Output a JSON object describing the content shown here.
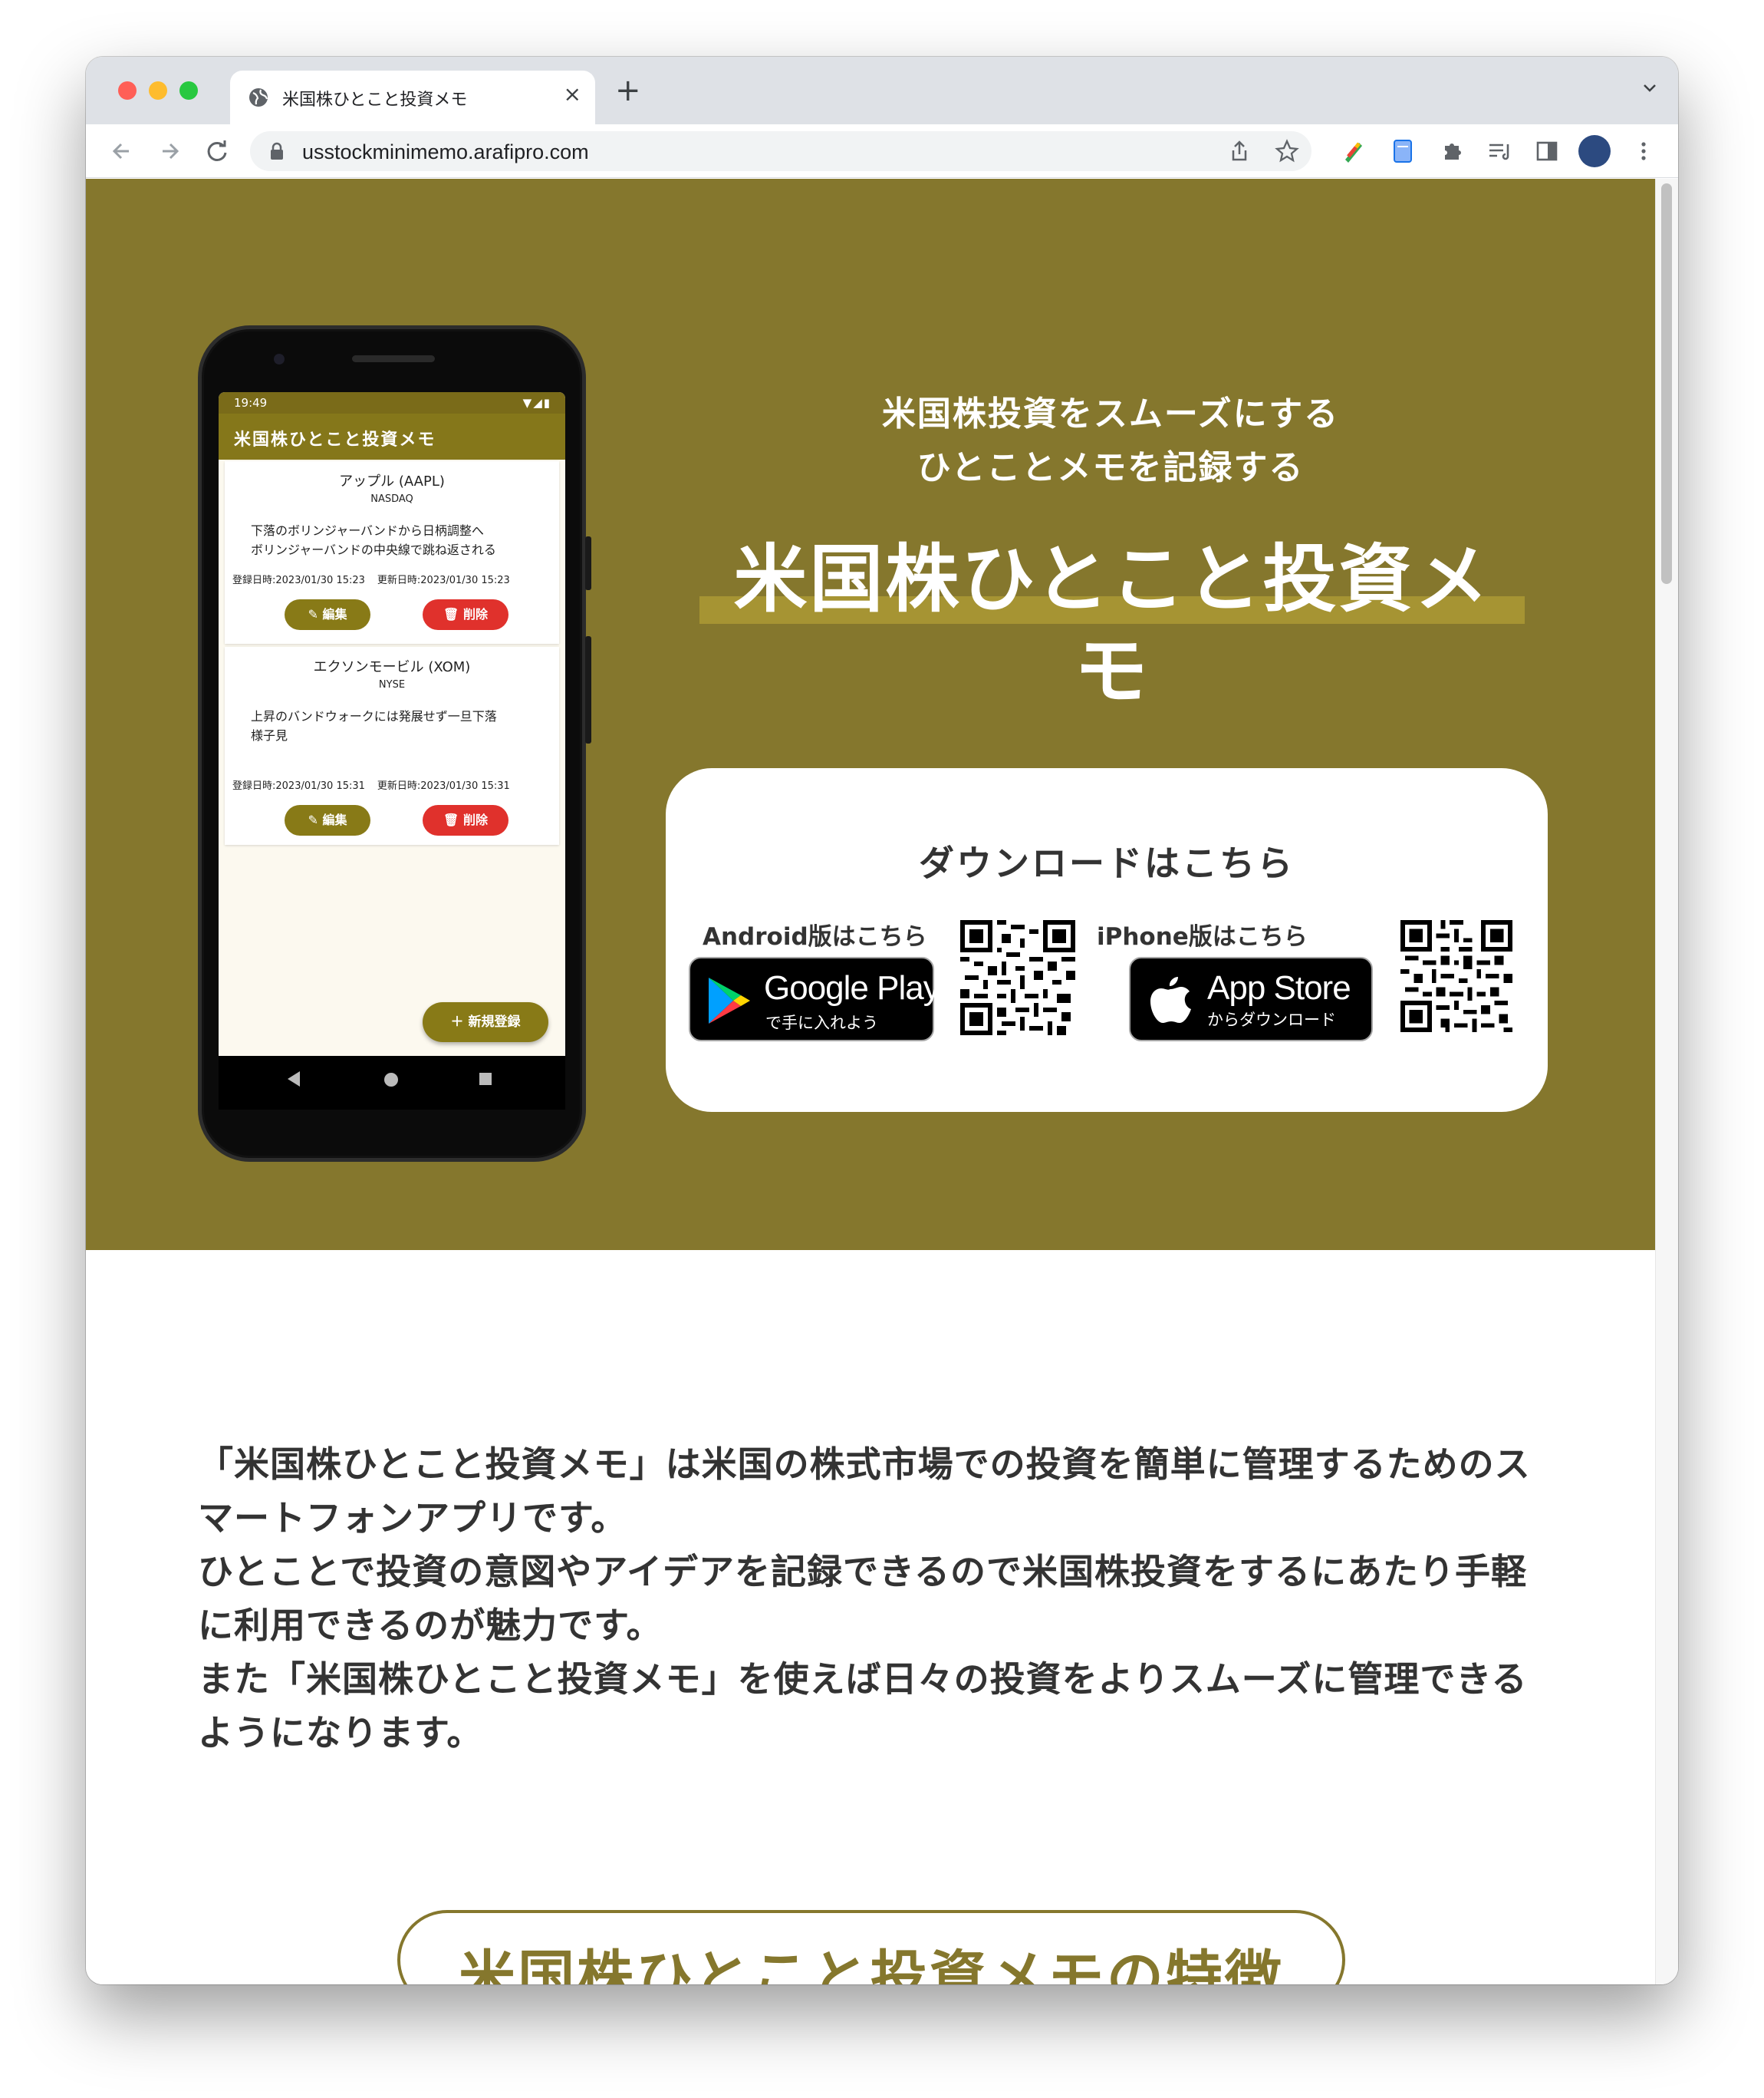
{
  "browser": {
    "tab_title": "米国株ひとこと投資メモ",
    "tab_close": "×",
    "new_tab": "+",
    "url": "usstockminimemo.arafipro.com"
  },
  "phone": {
    "status_time": "19:49",
    "status_icons": "▼◢▮",
    "app_title": "米国株ひとこと投資メモ",
    "cards": [
      {
        "name": "アップル (AAPL)",
        "market": "NASDAQ",
        "memo": "下落のボリンジャーバンドから日柄調整へ\nボリンジャーバンドの中央線で跳ね返される",
        "created": "登録日時:2023/01/30 15:23",
        "updated": "更新日時:2023/01/30 15:23",
        "edit": "編集",
        "delete": "削除"
      },
      {
        "name": "エクソンモービル (XOM)",
        "market": "NYSE",
        "memo": "上昇のバンドウォークには発展せず一旦下落\n様子見",
        "created": "登録日時:2023/01/30 15:31",
        "updated": "更新日時:2023/01/30 15:31",
        "edit": "編集",
        "delete": "削除"
      }
    ],
    "fab_label": "新規登録"
  },
  "hero": {
    "tagline_line1": "米国株投資をスムーズにする",
    "tagline_line2": "ひとことメモを記録する",
    "title": "米国株ひとこと投資メモ",
    "background_color": "#85772d"
  },
  "download": {
    "heading": "ダウンロードはこちら",
    "android_label": "Android版はこちら",
    "google_play_big": "Google Play",
    "google_play_small": "で手に入れよう",
    "iphone_label": "iPhone版はこちら",
    "app_store_big": "App Store",
    "app_store_small": "からダウンロード"
  },
  "intro": {
    "p1": "「米国株ひとこと投資メモ」は米国の株式市場での投資を簡単に管理するためのスマートフォンアプリです。",
    "p2": "ひとことで投資の意図やアイデアを記録できるので米国株投資をするにあたり手軽に利用できるのが魅力です。",
    "p3": "また「米国株ひとこと投資メモ」を使えば日々の投資をよりスムーズに管理できるようになります。"
  },
  "features": {
    "heading": "米国株ひとこと投資メモの特徴"
  },
  "icons": [
    "globe-icon",
    "back-arrow-icon",
    "forward-arrow-icon",
    "reload-icon",
    "lock-icon",
    "share-icon",
    "star-icon",
    "extensions-icon",
    "reading-list-icon",
    "side-panel-icon",
    "profile-avatar",
    "kebab-menu-icon"
  ]
}
